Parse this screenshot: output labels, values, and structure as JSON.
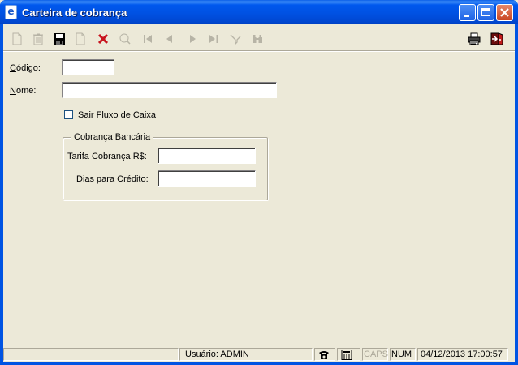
{
  "window": {
    "title": "Carteira de cobrança",
    "controls": [
      "minimize",
      "maximize",
      "close"
    ]
  },
  "toolbar": {
    "left": [
      {
        "name": "new-icon",
        "enabled": false
      },
      {
        "name": "delete-icon",
        "enabled": false
      },
      {
        "name": "save-icon",
        "enabled": true
      },
      {
        "name": "document-icon",
        "enabled": false
      },
      {
        "name": "cancel-icon",
        "enabled": true
      },
      {
        "name": "search-icon",
        "enabled": false
      },
      {
        "name": "first-record-icon",
        "enabled": false
      },
      {
        "name": "previous-record-icon",
        "enabled": false
      },
      {
        "name": "next-record-icon",
        "enabled": false
      },
      {
        "name": "last-record-icon",
        "enabled": false
      },
      {
        "name": "filter-icon",
        "enabled": false
      },
      {
        "name": "binoculars-icon",
        "enabled": false
      }
    ],
    "right": [
      {
        "name": "printer-icon",
        "enabled": true
      },
      {
        "name": "exit-icon",
        "enabled": true
      }
    ]
  },
  "form": {
    "codigo_label": "Código:",
    "codigo_value": "",
    "nome_label": "Nome:",
    "nome_value": "",
    "sair_fluxo_label": "Sair Fluxo de Caixa",
    "sair_fluxo_checked": false,
    "group_title": "Cobrança Bancária",
    "tarifa_label": "Tarifa Cobrança R$:",
    "tarifa_value": "",
    "dias_label": "Dias para Crédito:",
    "dias_value": ""
  },
  "status": {
    "user": "Usuário: ADMIN",
    "phone_icon": "phone-icon",
    "calc_icon": "calculator-icon",
    "caps": "CAPS",
    "num": "NUM",
    "datetime": "04/12/2013 17:00:57"
  }
}
